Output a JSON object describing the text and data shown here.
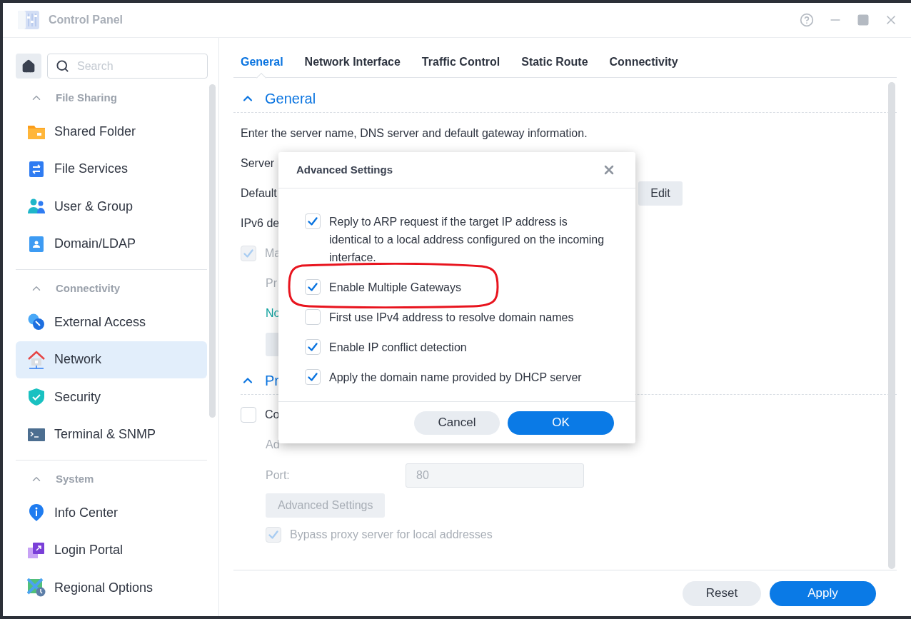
{
  "window": {
    "title": "Control Panel"
  },
  "sidebar": {
    "search": {
      "placeholder": "Search"
    },
    "sections": [
      {
        "title": "File Sharing",
        "expanded": true,
        "items": [
          {
            "label": "Shared Folder",
            "selected": false
          },
          {
            "label": "File Services",
            "selected": false
          },
          {
            "label": "User & Group",
            "selected": false
          },
          {
            "label": "Domain/LDAP",
            "selected": false
          }
        ]
      },
      {
        "title": "Connectivity",
        "expanded": true,
        "items": [
          {
            "label": "External Access",
            "selected": false
          },
          {
            "label": "Network",
            "selected": true
          },
          {
            "label": "Security",
            "selected": false
          },
          {
            "label": "Terminal & SNMP",
            "selected": false
          }
        ]
      },
      {
        "title": "System",
        "expanded": true,
        "items": [
          {
            "label": "Info Center",
            "selected": false
          },
          {
            "label": "Login Portal",
            "selected": false
          },
          {
            "label": "Regional Options",
            "selected": false
          }
        ]
      }
    ]
  },
  "tabs": [
    {
      "label": "General",
      "selected": true
    },
    {
      "label": "Network Interface",
      "selected": false
    },
    {
      "label": "Traffic Control",
      "selected": false
    },
    {
      "label": "Static Route",
      "selected": false
    },
    {
      "label": "Connectivity",
      "selected": false
    }
  ],
  "general_section": {
    "title": "General",
    "expanded": true,
    "description": "Enter the server name, DNS server and default gateway information.",
    "server_label": "Server",
    "gateway_label": "Default",
    "edit_button": "Edit",
    "ipv6_label": "IPv6 de",
    "manual_checkbox": {
      "label": "Ma",
      "checked": true,
      "disabled": true
    },
    "preferred_label": "Pr",
    "note": "No"
  },
  "proxy_section": {
    "title": "Pr",
    "expanded": true,
    "checkbox": {
      "label": "Co",
      "checked": false,
      "disabled": false
    },
    "address_label": "Ad",
    "port_label": "Port:",
    "port_value": "80",
    "advanced_button": "Advanced Settings",
    "bypass_checkbox": {
      "label": "Bypass proxy server for local addresses",
      "checked": true,
      "disabled": true
    }
  },
  "dialog": {
    "title": "Advanced Settings",
    "options": [
      {
        "label": "Reply to ARP request if the target IP address is identical to a local address configured on the incoming interface.",
        "checked": true,
        "annotated": false
      },
      {
        "label": "Enable Multiple Gateways",
        "checked": true,
        "annotated": true
      },
      {
        "label": "First use IPv4 address to resolve domain names",
        "checked": false,
        "annotated": false
      },
      {
        "label": "Enable IP conflict detection",
        "checked": true,
        "annotated": false
      },
      {
        "label": "Apply the domain name provided by DHCP server",
        "checked": true,
        "annotated": false
      }
    ],
    "buttons": [
      {
        "label": "Cancel",
        "kind": "secondary"
      },
      {
        "label": "OK",
        "kind": "primary"
      }
    ]
  },
  "footer": {
    "buttons": [
      {
        "label": "Reset",
        "kind": "secondary"
      },
      {
        "label": "Apply",
        "kind": "primary"
      }
    ]
  }
}
